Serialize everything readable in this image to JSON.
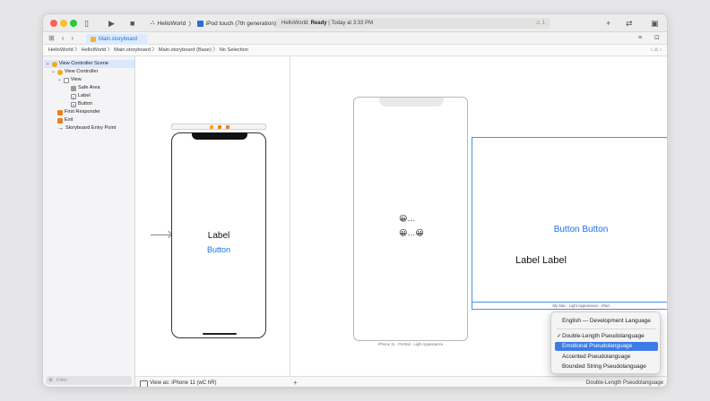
{
  "titlebar": {
    "scheme_app": "HelloWorld",
    "scheme_device": "iPod touch (7th generation)",
    "status_project": "HelloWorld:",
    "status_state": "Ready",
    "status_time": "Today at 3:33 PM",
    "warning_count": "1"
  },
  "tabbar": {
    "tab_label": "Main.storyboard"
  },
  "breadcrumb": {
    "path": "HelloWorld 〉 HelloWorld 〉 Main.storyboard 〉 Main.storyboard (Base) 〉 No Selection"
  },
  "navigator": {
    "items": [
      {
        "label": "View Controller Scene",
        "icon": "scene-icon"
      },
      {
        "label": "View Controller",
        "icon": "view-controller-icon"
      },
      {
        "label": "View",
        "icon": "view-icon"
      },
      {
        "label": "Safe Area",
        "icon": "safe-area-icon"
      },
      {
        "label": "Label",
        "icon": "label-icon",
        "glyph": "L"
      },
      {
        "label": "Button",
        "icon": "button-icon",
        "glyph": "B"
      },
      {
        "label": "First Responder",
        "icon": "first-responder-icon"
      },
      {
        "label": "Exit",
        "icon": "exit-icon"
      },
      {
        "label": "Storyboard Entry Point",
        "icon": "entry-arrow-icon"
      }
    ],
    "filter_placeholder": "Filter"
  },
  "storyboard": {
    "label_text": "Label",
    "button_text": "Button"
  },
  "preview_phone": {
    "emoji_line1": "😀…",
    "emoji_line2": "😀…😀",
    "caption": "iPhone 11 - Portrait - Light Appearance"
  },
  "preview_mac": {
    "button_text": "Button Button",
    "label_text": "Label Label",
    "caption": "My Mac - Light Appearance - iPad"
  },
  "bottombar": {
    "view_as": "View as: iPhone 11 (wC hR)",
    "language": "Double-Length Pseudolanguage"
  },
  "language_menu": {
    "items": [
      {
        "label": "English — Development Language",
        "checked": false,
        "highlighted": false
      },
      {
        "label": "Double-Length Pseudolanguage",
        "checked": true,
        "highlighted": false
      },
      {
        "label": "Emotional Pseudolanguage",
        "checked": false,
        "highlighted": true
      },
      {
        "label": "Accented Pseudolanguage",
        "checked": false,
        "highlighted": false
      },
      {
        "label": "Bounded String Pseudolanguage",
        "checked": false,
        "highlighted": false
      }
    ],
    "check_glyph": "✓"
  },
  "colors": {
    "accent": "#1a73e8",
    "highlight": "#3d7ce6",
    "warning": "#c08a00"
  }
}
